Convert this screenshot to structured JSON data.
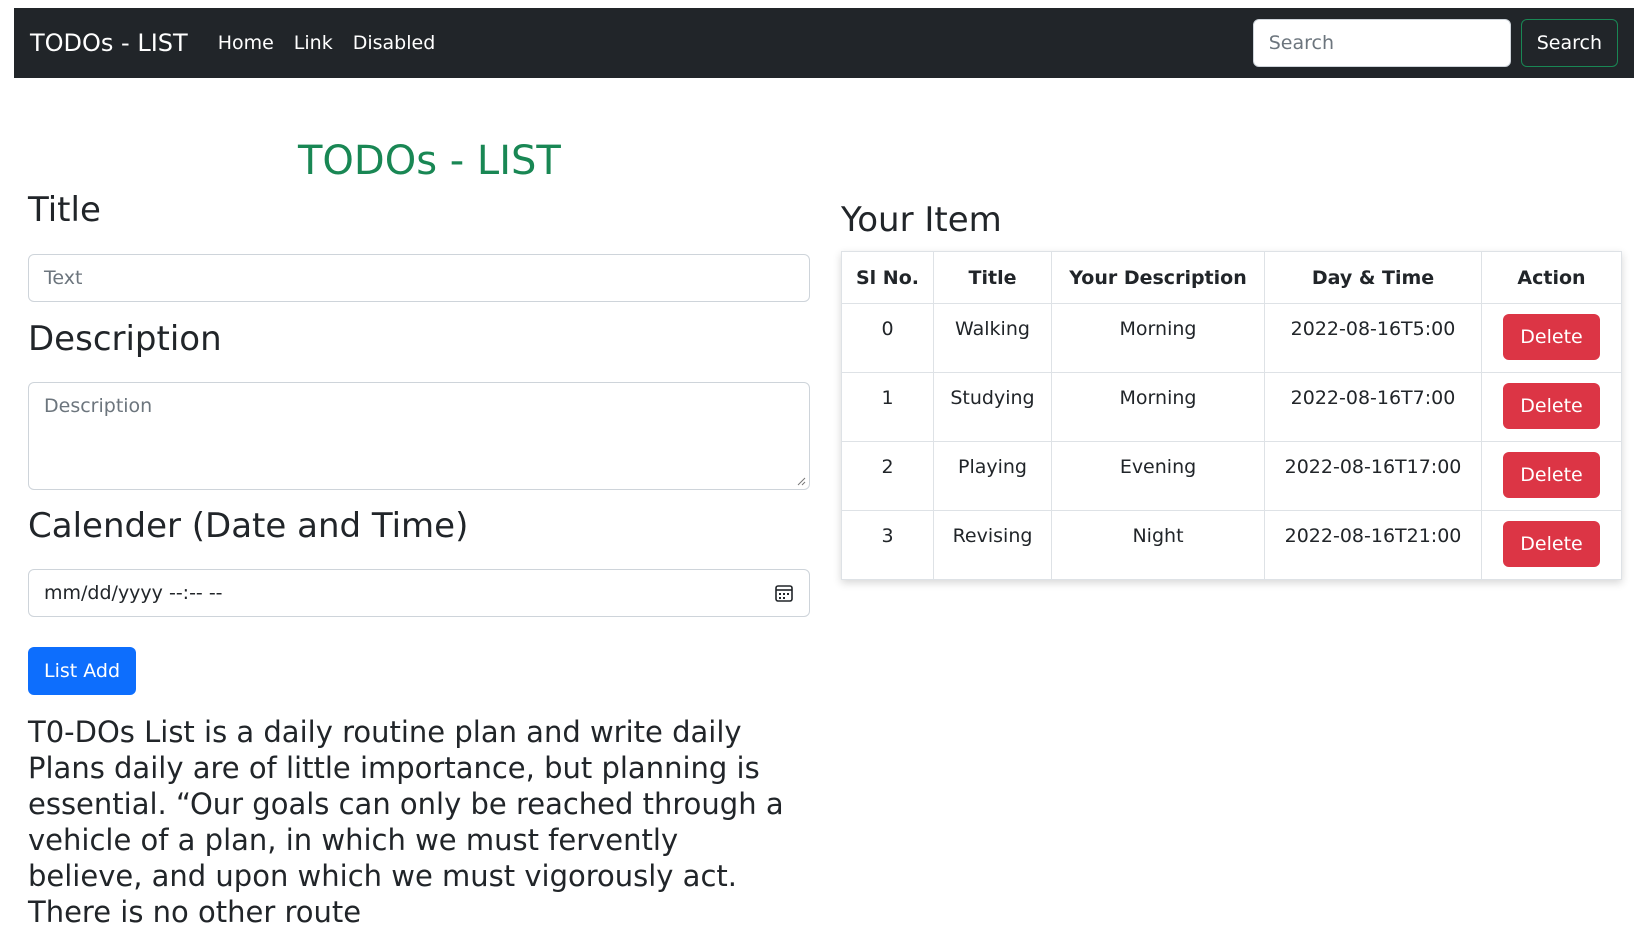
{
  "navbar": {
    "brand": "TODOs - LIST",
    "links": [
      {
        "label": "Home"
      },
      {
        "label": "Link"
      },
      {
        "label": "Disabled"
      }
    ],
    "search_placeholder": "Search",
    "search_button": "Search"
  },
  "colors": {
    "navbar_bg": "#212529",
    "title_green": "#198754",
    "primary_blue": "#0d6efd",
    "danger_red": "#dc3545"
  },
  "form": {
    "heading": "TODOs - LIST",
    "title_label": "Title",
    "title_placeholder": "Text",
    "description_label": "Description",
    "description_placeholder": "Description",
    "calendar_label": "Calender (Date and Time)",
    "date_value": "mm/dd/yyyy --:-- --",
    "submit_button": "List Add"
  },
  "quote": "T0-DOs List is a daily routine plan and write daily Plans daily are of little importance, but planning is essential. “Our goals can only be reached through a vehicle of a plan, in which we must fervently believe, and upon which we must vigorously act. There is no other route",
  "items": {
    "heading": "Your Item",
    "columns": [
      "Sl No.",
      "Title",
      "Your Description",
      "Day & Time",
      "Action"
    ],
    "rows": [
      {
        "sl": "0",
        "title": "Walking",
        "description": "Morning",
        "datetime": "2022-08-16T5:00",
        "action": "Delete"
      },
      {
        "sl": "1",
        "title": "Studying",
        "description": "Morning",
        "datetime": "2022-08-16T7:00",
        "action": "Delete"
      },
      {
        "sl": "2",
        "title": "Playing",
        "description": "Evening",
        "datetime": "2022-08-16T17:00",
        "action": "Delete"
      },
      {
        "sl": "3",
        "title": "Revising",
        "description": "Night",
        "datetime": "2022-08-16T21:00",
        "action": "Delete"
      }
    ]
  }
}
